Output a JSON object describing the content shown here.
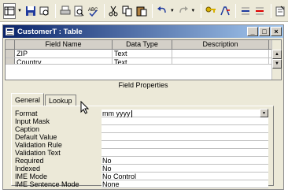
{
  "window": {
    "title": "CustomerT : Table",
    "minimize": "_",
    "restore": "□",
    "close": "×"
  },
  "grid": {
    "headers": [
      "Field Name",
      "Data Type",
      "Description"
    ],
    "rows": [
      {
        "name": "ZIP",
        "type": "Text",
        "desc": ""
      },
      {
        "name": "Country",
        "type": "Text",
        "desc": ""
      }
    ]
  },
  "field_properties": {
    "label": "Field Properties",
    "tabs": [
      "General",
      "Lookup"
    ],
    "properties": [
      {
        "label": "Format",
        "value": "mm yyyy"
      },
      {
        "label": "Input Mask",
        "value": ""
      },
      {
        "label": "Caption",
        "value": ""
      },
      {
        "label": "Default Value",
        "value": ""
      },
      {
        "label": "Validation Rule",
        "value": ""
      },
      {
        "label": "Validation Text",
        "value": ""
      },
      {
        "label": "Required",
        "value": "No"
      },
      {
        "label": "Indexed",
        "value": "No"
      },
      {
        "label": "IME Mode",
        "value": "No Control"
      },
      {
        "label": "IME Sentence Mode",
        "value": "None"
      }
    ]
  },
  "toolbar": {
    "icons": [
      "view-icon",
      "save-icon",
      "find-icon",
      "print-icon",
      "print-preview-icon",
      "spelling-icon",
      "cut-icon",
      "copy-icon",
      "paste-icon",
      "undo-icon",
      "redo-icon",
      "primary-key-icon",
      "indexes-icon",
      "insert-rows-icon",
      "delete-rows-icon",
      "properties-icon"
    ]
  }
}
